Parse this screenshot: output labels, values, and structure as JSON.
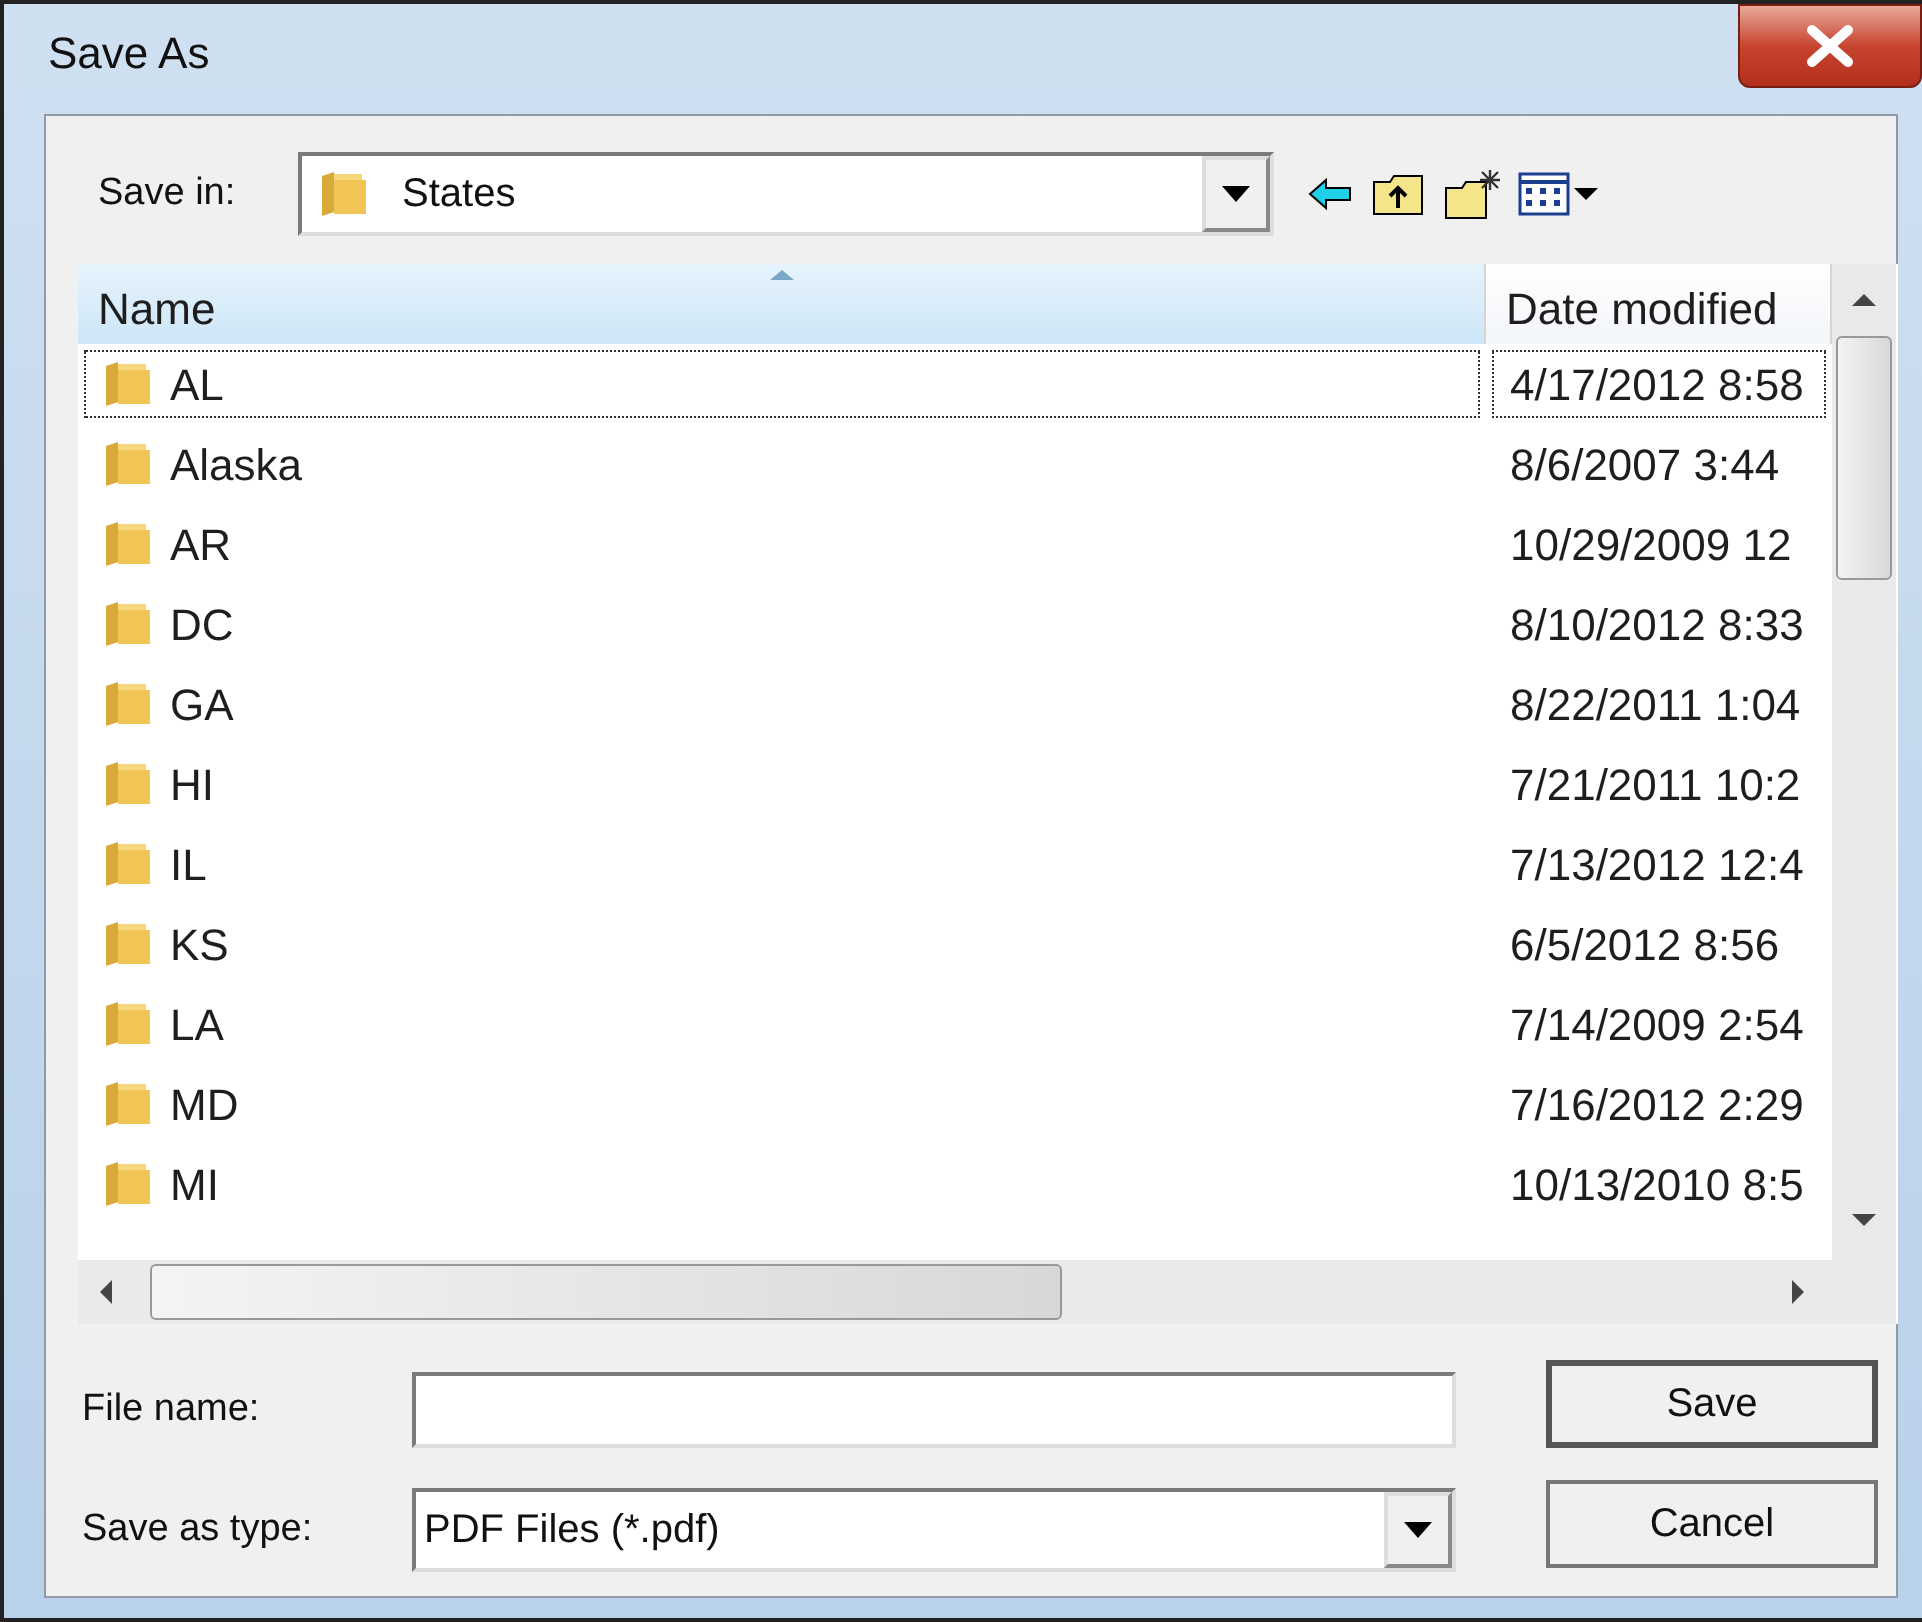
{
  "window": {
    "title": "Save As"
  },
  "save_in": {
    "label": "Save in:",
    "value": "States"
  },
  "table": {
    "columns": [
      {
        "label": "Name",
        "sorted": true
      },
      {
        "label": "Date modified",
        "sorted": false
      }
    ],
    "rows": [
      {
        "name": "AL",
        "date": "4/17/2012 8:58",
        "focused": true
      },
      {
        "name": "Alaska",
        "date": "8/6/2007 3:44",
        "focused": false
      },
      {
        "name": "AR",
        "date": "10/29/2009 12",
        "focused": false
      },
      {
        "name": "DC",
        "date": "8/10/2012 8:33",
        "focused": false
      },
      {
        "name": "GA",
        "date": "8/22/2011 1:04",
        "focused": false
      },
      {
        "name": "HI",
        "date": "7/21/2011 10:2",
        "focused": false
      },
      {
        "name": "IL",
        "date": "7/13/2012 12:4",
        "focused": false
      },
      {
        "name": "KS",
        "date": "6/5/2012 8:56",
        "focused": false
      },
      {
        "name": "LA",
        "date": "7/14/2009 2:54",
        "focused": false
      },
      {
        "name": "MD",
        "date": "7/16/2012 2:29",
        "focused": false
      },
      {
        "name": "MI",
        "date": "10/13/2010 8:5",
        "focused": false
      }
    ]
  },
  "file_name": {
    "label": "File name:"
  },
  "save_as_type": {
    "label": "Save as type:",
    "value": "PDF Files (*.pdf)"
  },
  "buttons": [
    {
      "label": "Save",
      "default": true
    },
    {
      "label": "Cancel",
      "default": false
    }
  ]
}
